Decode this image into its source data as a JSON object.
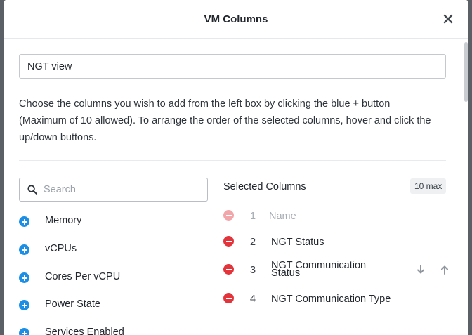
{
  "dialog": {
    "title": "VM Columns",
    "close_icon": "close-icon"
  },
  "view_name": {
    "value": "NGT view"
  },
  "instructions": "Choose the columns you wish to add from the left box by clicking the blue + button (Maximum of 10 allowed). To arrange the order of the selected columns, hover and click the up/down buttons.",
  "search": {
    "placeholder": "Search",
    "icon": "search-icon"
  },
  "available_columns": [
    {
      "label": "Memory",
      "icon": "plus-circle-icon"
    },
    {
      "label": "vCPUs",
      "icon": "plus-circle-icon"
    },
    {
      "label": "Cores Per vCPU",
      "icon": "plus-circle-icon"
    },
    {
      "label": "Power State",
      "icon": "plus-circle-icon"
    },
    {
      "label": "Services Enabled",
      "icon": "plus-circle-icon"
    }
  ],
  "selected": {
    "title": "Selected Columns",
    "max_badge": "10 max",
    "rows": [
      {
        "index": "1",
        "label": "Name",
        "removable": false
      },
      {
        "index": "2",
        "label": "NGT Status",
        "removable": true
      },
      {
        "index": "3",
        "label": "NGT Communication Status",
        "removable": true,
        "hovered": true
      },
      {
        "index": "4",
        "label": "NGT Communication Type",
        "removable": true
      }
    ]
  },
  "colors": {
    "add_blue": "#1b8fe6",
    "remove_red": "#e3343b",
    "remove_disabled": "#f3a6a9",
    "arrow_gray": "#8f969e"
  }
}
